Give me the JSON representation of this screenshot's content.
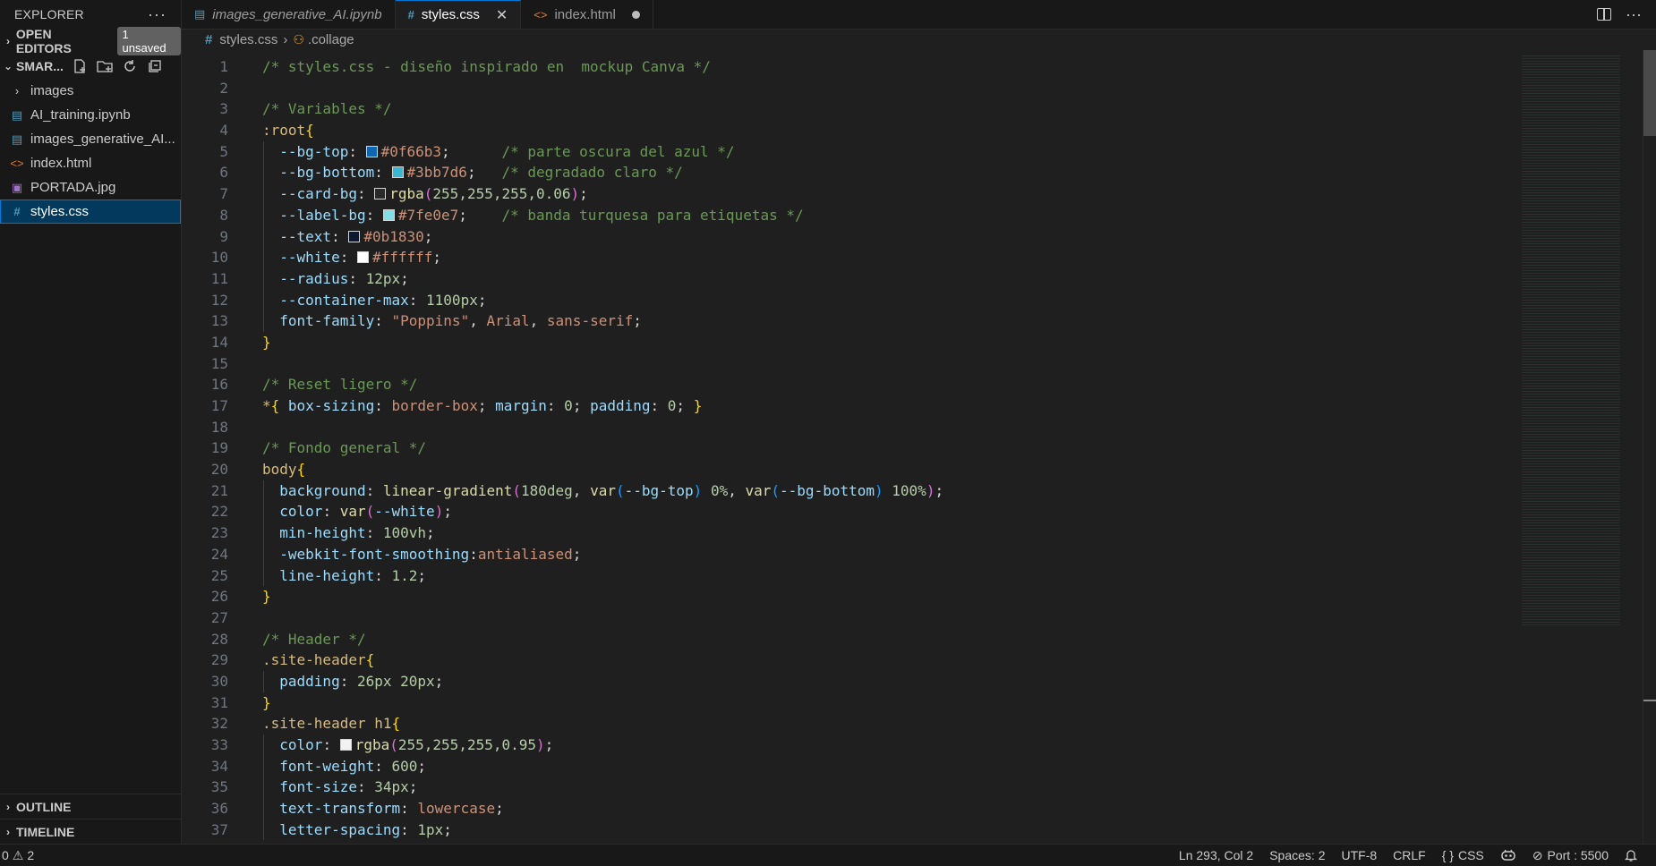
{
  "sidebar": {
    "title": "EXPLORER",
    "more_icon": "ellipsis-icon",
    "open_editors": {
      "label": "OPEN EDITORS",
      "badge": "1 unsaved"
    },
    "project": {
      "label": "SMAR..."
    },
    "items": [
      {
        "label": "images",
        "kind": "folder"
      },
      {
        "label": "AI_training.ipynb",
        "kind": "notebook"
      },
      {
        "label": "images_generative_AI...",
        "kind": "notebook"
      },
      {
        "label": "index.html",
        "kind": "html"
      },
      {
        "label": "PORTADA.jpg",
        "kind": "image"
      },
      {
        "label": "styles.css",
        "kind": "css",
        "selected": true
      }
    ],
    "outline": "OUTLINE",
    "timeline": "TIMELINE"
  },
  "tabs": [
    {
      "label": "images_generative_AI.ipynb"
    },
    {
      "label": "styles.css"
    },
    {
      "label": "index.html"
    }
  ],
  "breadcrumb": {
    "file": "styles.css",
    "symbol": ".collage"
  },
  "editor": {
    "line_numbers": [
      "1",
      "2",
      "3",
      "4",
      "5",
      "6",
      "7",
      "8",
      "9",
      "10",
      "11",
      "12",
      "13",
      "14",
      "15",
      "16",
      "17",
      "18",
      "19",
      "20",
      "21",
      "22",
      "23",
      "24",
      "25",
      "26",
      "27",
      "28",
      "29",
      "30",
      "31",
      "32",
      "33",
      "34",
      "35",
      "36",
      "37"
    ],
    "l1": {
      "comment": "/* styles.css - diseño inspirado en  mockup Canva */"
    },
    "l3": {
      "comment": "/* Variables */"
    },
    "l4": {
      "selector": ":root",
      "brace": "{"
    },
    "l5": {
      "prop": "--bg-top",
      "value": "#0f66b3",
      "comment": "/* parte oscura del azul */",
      "swatch": "#0f66b3"
    },
    "l6": {
      "prop": "--bg-bottom",
      "value": "#3bb7d6",
      "comment": "/* degradado claro */",
      "swatch": "#3bb7d6"
    },
    "l7": {
      "prop": "--card-bg",
      "fn": "rgba",
      "args": "255,255,255,0.06",
      "swatch": "#2a2a2a"
    },
    "l8": {
      "prop": "--label-bg",
      "value": "#7fe0e7",
      "comment": "/* banda turquesa para etiquetas */",
      "swatch": "#7fe0e7"
    },
    "l9": {
      "prop": "--text",
      "value": "#0b1830",
      "swatch": "#0b1830"
    },
    "l10": {
      "prop": "--white",
      "value": "#ffffff",
      "swatch": "#ffffff"
    },
    "l11": {
      "prop": "--radius",
      "value": "12px"
    },
    "l12": {
      "prop": "--container-max",
      "value": "1100px"
    },
    "l13": {
      "prop": "font-family",
      "v1": "\"Poppins\"",
      "v2": "Arial",
      "v3": "sans-serif"
    },
    "l14": {
      "brace": "}"
    },
    "l16": {
      "comment": "/* Reset ligero */"
    },
    "l17": {
      "selector": "*",
      "brace_open": "{",
      "p1": "box-sizing",
      "v1": "border-box",
      "p2": "margin",
      "v2": "0",
      "p3": "padding",
      "v3": "0",
      "brace_close": "}"
    },
    "l19": {
      "comment": "/* Fondo general */"
    },
    "l20": {
      "selector": "body",
      "brace": "{"
    },
    "l21": {
      "prop": "background",
      "fn": "linear-gradient",
      "a1": "180deg",
      "var": "var",
      "v1": "--bg-top",
      "p1": "0%",
      "v2": "--bg-bottom",
      "p2": "100%"
    },
    "l22": {
      "prop": "color",
      "var": "var",
      "v1": "--white"
    },
    "l23": {
      "prop": "min-height",
      "value": "100vh"
    },
    "l24": {
      "prop": "-webkit-font-smoothing",
      "value": "antialiased"
    },
    "l25": {
      "prop": "line-height",
      "value": "1.2"
    },
    "l26": {
      "brace": "}"
    },
    "l28": {
      "comment": "/* Header */"
    },
    "l29": {
      "selector": ".site-header",
      "brace": "{"
    },
    "l30": {
      "prop": "padding",
      "value": "26px 20px"
    },
    "l31": {
      "brace": "}"
    },
    "l32": {
      "selector": ".site-header h1",
      "brace": "{"
    },
    "l33": {
      "prop": "color",
      "fn": "rgba",
      "args": "255,255,255,0.95",
      "swatch": "#f2f2f2"
    },
    "l34": {
      "prop": "font-weight",
      "value": "600"
    },
    "l35": {
      "prop": "font-size",
      "value": "34px"
    },
    "l36": {
      "prop": "text-transform",
      "value": "lowercase"
    },
    "l37": {
      "prop": "letter-spacing",
      "value": "1px"
    }
  },
  "status": {
    "errors": "0",
    "warnings": "2",
    "position": "Ln 293, Col 2",
    "spaces": "Spaces: 2",
    "encoding": "UTF-8",
    "eol": "CRLF",
    "language": "CSS",
    "port": "Port : 5500"
  }
}
